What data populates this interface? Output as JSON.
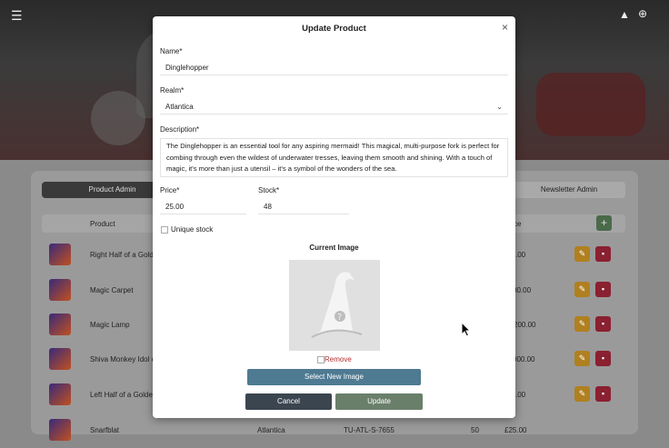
{
  "header": {
    "menu_icon": "☰",
    "wizard_icon": "⛺",
    "cart_icon": "🛒"
  },
  "tabs": [
    {
      "label": "Product Admin"
    },
    {
      "label": "Newsletter Admin"
    }
  ],
  "table": {
    "headers": {
      "product": "Product",
      "price": "ce"
    },
    "add": "+",
    "rows": [
      {
        "name": "Right Half of a Gold",
        "realm": "",
        "sku": "",
        "stock": "",
        "price": ".00"
      },
      {
        "name": "Magic Carpet",
        "realm": "",
        "sku": "",
        "stock": "",
        "price": "00.00"
      },
      {
        "name": "Magic Lamp",
        "realm": "",
        "sku": "",
        "stock": "",
        "price": "200.00"
      },
      {
        "name": "Shiva Monkey Idol o",
        "realm": "",
        "sku": "",
        "stock": "",
        "price": "000.00"
      },
      {
        "name": "Left Half of a Golde",
        "realm": "",
        "sku": "",
        "stock": "",
        "price": ".00"
      },
      {
        "name": "Snarfblat",
        "realm": "Atlantica",
        "sku": "TU-ATL-S-7655",
        "stock": "50",
        "price": "£25.00"
      }
    ]
  },
  "modal": {
    "title": "Update Product",
    "close": "×",
    "name_label": "Name*",
    "name_value": "Dinglehopper",
    "realm_label": "Realm*",
    "realm_value": "Atlantica",
    "description_label": "Description*",
    "description_value": "The Dinglehopper is an essential tool for any aspiring mermaid! This magical, multi-purpose fork is perfect for combing through even the wildest of underwater tresses, leaving them smooth and shining. With a touch of magic, it's more than just a utensil – it's a symbol of the wonders of the sea.",
    "price_label": "Price*",
    "price_value": "25.00",
    "stock_label": "Stock*",
    "stock_value": "48",
    "unique_stock_label": "Unique stock",
    "current_image_label": "Current Image",
    "remove_label": "Remove",
    "select_image_label": "Select New Image",
    "cancel_label": "Cancel",
    "update_label": "Update"
  },
  "colors": {
    "select_btn": "#4e7a92",
    "cancel_btn": "#3a4550",
    "update_btn": "#6a7f6a",
    "remove": "#b03030"
  }
}
